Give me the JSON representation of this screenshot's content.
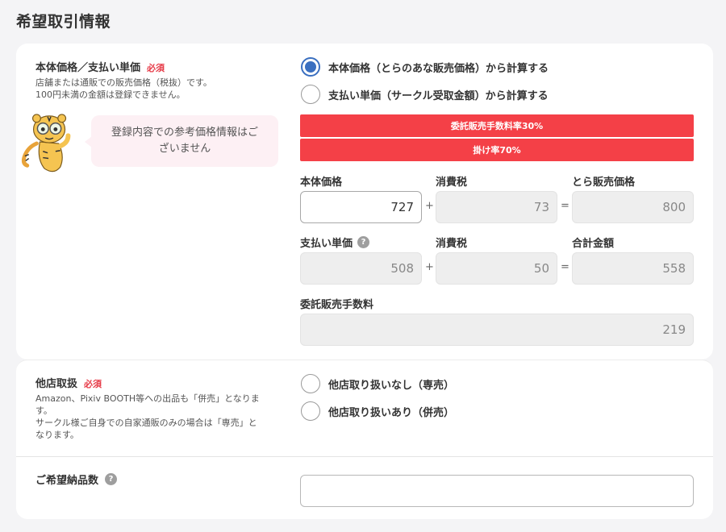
{
  "page": {
    "title": "希望取引情報"
  },
  "price_section": {
    "title": "本体価格／支払い単価",
    "required": "必須",
    "description": [
      "店舗または通販での販売価格（税抜）です。",
      "100円未満の金額は登録できません。"
    ],
    "bubble": [
      "登録内容での参考価格情報はご",
      "ざいません"
    ],
    "mascot_icon": "tiger-mascot-icon",
    "radio_options": [
      {
        "label": "本体価格（とらのあな販売価格）から計算する",
        "checked": true
      },
      {
        "label": "支払い単価（サークル受取金額）から計算する",
        "checked": false
      }
    ],
    "commission_bar": "委託販売手数料率30%",
    "kake_bar": "掛け率70%",
    "row1": {
      "label_base": "本体価格",
      "label_tax": "消費税",
      "label_total": "とら販売価格",
      "base": "727",
      "tax": "73",
      "total": "800"
    },
    "row2": {
      "label_base": "支払い単価",
      "label_tax": "消費税",
      "label_total": "合計金額",
      "base": "508",
      "tax": "50",
      "total": "558"
    },
    "commission": {
      "label": "委託販売手数料",
      "value": "219"
    },
    "ops": {
      "plus": "+",
      "equals": "="
    },
    "help_glyph": "?"
  },
  "other_store": {
    "title": "他店取扱",
    "required": "必須",
    "description": [
      "Amazon、Pixiv BOOTH等への出品も「併売」となりま",
      "す。",
      "サークル様ご自身での自家通販のみの場合は「専売」と",
      "なります。"
    ],
    "radio_options": [
      {
        "label": "他店取り扱いなし（専売）",
        "checked": false
      },
      {
        "label": "他店取り扱いあり（併売）",
        "checked": false
      }
    ]
  },
  "delivery": {
    "title": "ご希望納品数",
    "value": ""
  },
  "colors": {
    "accent": "#3a6fc0",
    "alert": "#f44047",
    "required": "#e63946"
  }
}
